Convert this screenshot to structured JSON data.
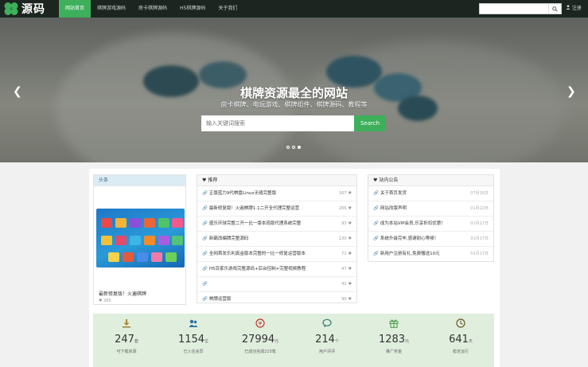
{
  "brand": {
    "logo_text": "源码"
  },
  "nav": {
    "items": [
      {
        "label": "网站首页",
        "active": true
      },
      {
        "label": "棋牌游戏源码",
        "active": false
      },
      {
        "label": "房卡棋牌源码",
        "active": false
      },
      {
        "label": "H5棋牌源码",
        "active": false
      },
      {
        "label": "关于我们",
        "active": false
      }
    ],
    "search_placeholder": "",
    "register": "注册"
  },
  "hero": {
    "title": "棋牌资源最全的网站",
    "subtitle": "房卡棋牌、电玩游戏、棋牌组件、棋牌源码、教程等",
    "search_placeholder": "输入关键词搜索",
    "search_button": "Search",
    "slides": 3,
    "active_slide": 3
  },
  "headline": {
    "title": "头条",
    "item_title": "最新修复版！火遍棋牌",
    "likes": "265"
  },
  "recommend": {
    "title": "推荐",
    "items": [
      {
        "text": "正版蓝力9代棋盘Linux无缝完整版",
        "count": "167"
      },
      {
        "text": "最新修复版！火遍棋牌1.1二开全代理完整运营",
        "count": "206"
      },
      {
        "text": "盛乐环球完整二开一比一版本现版代理系统完整",
        "count": "93"
      },
      {
        "text": "新霸改编牌完整源码",
        "count": "130"
      },
      {
        "text": "全网首发乐利真金版本完整的一比一修复运营版本",
        "count": "71"
      },
      {
        "text": "H5百家乐游戏完整源码+后台控制+完整视频教程",
        "count": "47"
      },
      {
        "text": "",
        "count": "42"
      },
      {
        "text": "棋牌运营版",
        "count": "90"
      }
    ]
  },
  "notice": {
    "title": "站内公告",
    "items": [
      {
        "text": "关于首页发货",
        "date": "07月16日"
      },
      {
        "text": "网站改版声明",
        "date": "01月22日"
      },
      {
        "text": "成为本站VIP会员,乐享折扣优惠！",
        "date": "01月17日"
      },
      {
        "text": "系统升级完毕,感谢耐心等候！",
        "date": "01月17日"
      },
      {
        "text": "新用户注册有礼,免费赠送10元",
        "date": "01月17日"
      }
    ]
  },
  "stats": [
    {
      "icon": "download-icon",
      "value": "247",
      "unit": "套",
      "label": "可下载资源"
    },
    {
      "icon": "users-icon",
      "value": "1154",
      "unit": "位",
      "label": "已入住会员"
    },
    {
      "icon": "money-icon",
      "value": "27994",
      "unit": "元",
      "label": "已成功完成215笔"
    },
    {
      "icon": "comment-icon",
      "value": "214",
      "unit": "个",
      "label": "用户评评"
    },
    {
      "icon": "gift-icon",
      "value": "1283",
      "unit": "元",
      "label": "推广奖金"
    },
    {
      "icon": "clock-icon",
      "value": "641",
      "unit": "天",
      "label": "稳定运行"
    }
  ],
  "colors": {
    "accent": "#3eaf5a",
    "nav_bg": "#1c2520",
    "stats_bg": "#dfeedd"
  }
}
